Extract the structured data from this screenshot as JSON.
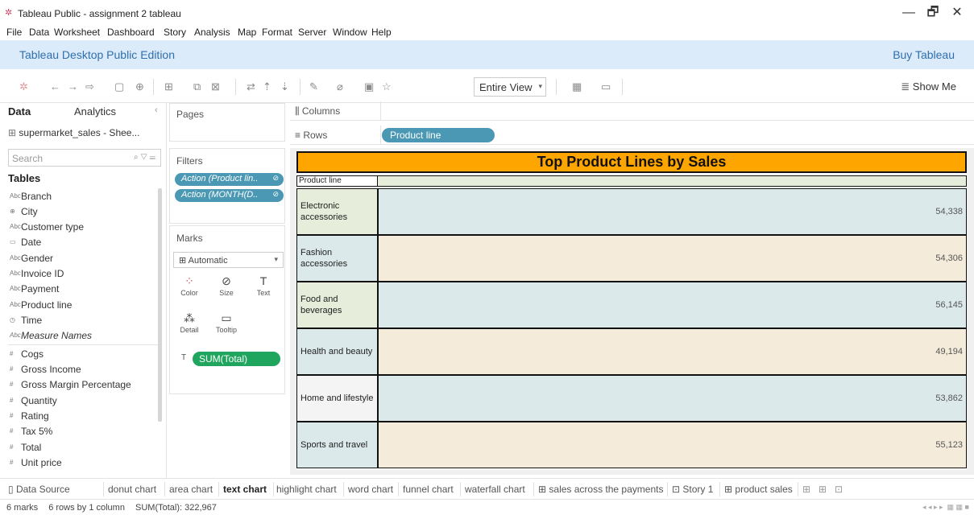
{
  "window": {
    "title": "Tableau Public - assignment 2 tableau",
    "minimize": "—",
    "maximize": "🗗",
    "close": "✕"
  },
  "menu": [
    "File",
    "Data",
    "Worksheet",
    "Dashboard",
    "Story",
    "Analysis",
    "Map",
    "Format",
    "Server",
    "Window",
    "Help"
  ],
  "banner": {
    "edition": "Tableau Desktop Public Edition",
    "buy": "Buy Tableau"
  },
  "toolbar": {
    "fit": "Entire View",
    "show_me": "Show Me"
  },
  "data_pane": {
    "tab_data": "Data",
    "tab_analytics": "Analytics",
    "datasource": "supermarket_sales - Shee...",
    "search_placeholder": "Search",
    "tables_heading": "Tables",
    "fields": [
      {
        "type": "Abc",
        "name": "Branch"
      },
      {
        "type": "⊕",
        "name": "City"
      },
      {
        "type": "Abc",
        "name": "Customer type"
      },
      {
        "type": "▭",
        "name": "Date"
      },
      {
        "type": "Abc",
        "name": "Gender"
      },
      {
        "type": "Abc",
        "name": "Invoice ID"
      },
      {
        "type": "Abc",
        "name": "Payment"
      },
      {
        "type": "Abc",
        "name": "Product line"
      },
      {
        "type": "◷",
        "name": "Time"
      },
      {
        "type": "Abc",
        "name": "Measure Names"
      },
      {
        "type": "#",
        "name": "Cogs"
      },
      {
        "type": "#",
        "name": "Gross Income"
      },
      {
        "type": "#",
        "name": "Gross Margin Percentage"
      },
      {
        "type": "#",
        "name": "Quantity"
      },
      {
        "type": "#",
        "name": "Rating"
      },
      {
        "type": "#",
        "name": "Tax 5%"
      },
      {
        "type": "#",
        "name": "Total"
      },
      {
        "type": "#",
        "name": "Unit price"
      }
    ]
  },
  "cards": {
    "pages": "Pages",
    "filters": "Filters",
    "filter_pills": [
      "Action (Product lin..",
      "Action (MONTH(D.."
    ],
    "marks": "Marks",
    "mark_type": "Automatic",
    "mark_buttons": [
      {
        "icon": "⁘",
        "label": "Color"
      },
      {
        "icon": "⊘",
        "label": "Size"
      },
      {
        "icon": "T",
        "label": "Text"
      },
      {
        "icon": "⁂",
        "label": "Detail"
      },
      {
        "icon": "▭",
        "label": "Tooltip"
      }
    ],
    "measure_pill": "SUM(Total)"
  },
  "shelves": {
    "columns": "Columns",
    "rows": "Rows",
    "row_pill": "Product line"
  },
  "viz": {
    "title": "Top Product Lines by Sales",
    "header": "Product line",
    "rows": [
      {
        "label": "Electronic accessories",
        "value": "54,338"
      },
      {
        "label": "Fashion accessories",
        "value": "54,306"
      },
      {
        "label": "Food and beverages",
        "value": "56,145"
      },
      {
        "label": "Health and beauty",
        "value": "49,194"
      },
      {
        "label": "Home and lifestyle",
        "value": "53,862"
      },
      {
        "label": "Sports and travel",
        "value": "55,123"
      }
    ],
    "colors": {
      "title_bg": "#ffa500",
      "row_label_alt": [
        "#e6eddb",
        "#dce9ea",
        "#e6eddb",
        "#dce9ea",
        "#f4f4f4",
        "#dce9ea"
      ],
      "row_fill_alt": [
        "#dce9ea",
        "#f4ebda",
        "#dce9ea",
        "#f4ebda",
        "#dce9ea",
        "#f4ebda"
      ]
    }
  },
  "sheet_tabs": [
    "Data Source",
    "donut chart",
    "area chart",
    "text chart",
    "highlight chart",
    "word chart",
    "funnel chart",
    "waterfall chart",
    "sales across the payments",
    "Story 1",
    "product sales"
  ],
  "active_tab": "text chart",
  "status": {
    "marks": "6 marks",
    "dims": "6 rows by 1 column",
    "sum": "SUM(Total): 322,967"
  }
}
